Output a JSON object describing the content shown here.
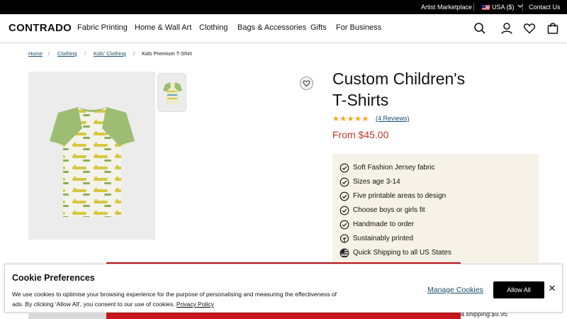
{
  "topbar": {
    "artist_marketplace": "Artist Marketplace",
    "currency": "USA ($)",
    "contact": "Contact Us"
  },
  "nav": {
    "logo": "CONTRADO",
    "links": [
      "Fabric Printing",
      "Home & Wall Art",
      "Clothing",
      "Bags & Accessories",
      "Gifts",
      "For Business"
    ],
    "icons": [
      "search-icon",
      "account-icon",
      "heart-icon",
      "bag-icon"
    ]
  },
  "breadcrumb": [
    "Home",
    "Clothing",
    "Kids' Clothing",
    "Kids Premium T-Shirt"
  ],
  "product": {
    "title_line1": "Custom Children's",
    "title_line2": "T-Shirts",
    "rating": 5,
    "reviews": "(4 Reviews)",
    "price": "From $45.00",
    "features": [
      {
        "icon": "check-circle-icon",
        "text": "Soft Fashion Jersey fabric"
      },
      {
        "icon": "check-circle-icon",
        "text": "Sizes age 3-14"
      },
      {
        "icon": "check-circle-icon",
        "text": "Five printable areas to design"
      },
      {
        "icon": "check-circle-icon",
        "text": "Choose boys or girls fit"
      },
      {
        "icon": "check-circle-icon",
        "text": "Handmade to order"
      },
      {
        "icon": "leaf-icon",
        "text": "Sustainably printed"
      },
      {
        "icon": "us-flag-icon",
        "text": "Quick Shipping to all US States"
      }
    ],
    "shipping_peek": "a shipping:$9.95"
  },
  "cookie": {
    "title": "Cookie Preferences",
    "body": "We use cookies to optimise your browsing experience for the purpose of personalising and measuring the effectiveness of ads. By clicking 'Allow All', you consent to our use of cookies. ",
    "privacy_link": "Privacy Policy",
    "manage": "Manage Cookies",
    "allow_all": "Allow All",
    "close": "✕"
  },
  "colors": {
    "price": "#c0392b",
    "stars": "#f2a51e",
    "link": "#1a4d6b",
    "features_bg": "#f7f2e7",
    "accent_red": "#c7151e"
  }
}
